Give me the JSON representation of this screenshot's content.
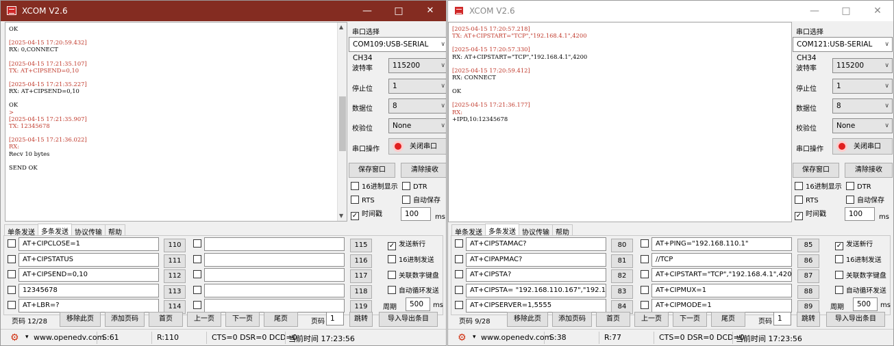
{
  "windows": [
    {
      "title": "XCOM V2.6",
      "log": [
        {
          "type": "text",
          "text": "OK"
        },
        {
          "type": "gap"
        },
        {
          "type": "ts",
          "text": "[2025-04-15 17:20:59.432]"
        },
        {
          "type": "text",
          "text": "RX: 0,CONNECT"
        },
        {
          "type": "gap"
        },
        {
          "type": "ts",
          "text": "[2025-04-15 17:21:35.107]"
        },
        {
          "type": "tx",
          "text": "TX: AT+CIPSEND=0,10"
        },
        {
          "type": "gap"
        },
        {
          "type": "ts",
          "text": "[2025-04-15 17:21:35.227]"
        },
        {
          "type": "text",
          "text": "RX: AT+CIPSEND=0,10"
        },
        {
          "type": "gap"
        },
        {
          "type": "text",
          "text": "OK"
        },
        {
          "type": "ts",
          "text": ">"
        },
        {
          "type": "ts",
          "text": "[2025-04-15 17:21:35.907]"
        },
        {
          "type": "tx",
          "text": "TX: 12345678"
        },
        {
          "type": "gap"
        },
        {
          "type": "ts",
          "text": "[2025-04-15 17:21:36.022]"
        },
        {
          "type": "ts",
          "text": "RX:"
        },
        {
          "type": "text",
          "text": "Recv 10 bytes"
        },
        {
          "type": "gap"
        },
        {
          "type": "text",
          "text": "SEND OK"
        }
      ],
      "side": {
        "port_label": "串口选择",
        "port_value": "COM109:USB-SERIAL CH34",
        "baud_label": "波特率",
        "baud_value": "115200",
        "stop_label": "停止位",
        "stop_value": "1",
        "data_label": "数据位",
        "data_value": "8",
        "parity_label": "校验位",
        "parity_value": "None",
        "op_label": "串口操作",
        "close_port": "关闭串口",
        "save_window": "保存窗口",
        "clear_recv": "清除接收",
        "hex_display": "16进制显示",
        "dtr": "DTR",
        "rts": "RTS",
        "auto_save": "自动保存",
        "timestamp": "时间戳",
        "timestamp_value": "100",
        "ms": "ms"
      },
      "tabs": [
        "单条发送",
        "多条发送",
        "协议传输",
        "帮助"
      ],
      "rows": [
        {
          "cmd": "AT+CIPCLOSE=1",
          "num": "110",
          "cmd2": "",
          "num2": "115"
        },
        {
          "cmd": "AT+CIPSTATUS",
          "num": "111",
          "cmd2": "",
          "num2": "116"
        },
        {
          "cmd": "AT+CIPSEND=0,10",
          "num": "112",
          "cmd2": "",
          "num2": "117"
        },
        {
          "cmd": "12345678",
          "num": "113",
          "cmd2": "",
          "num2": "118"
        },
        {
          "cmd": "AT+LBR=?",
          "num": "114",
          "cmd2": "",
          "num2": "119"
        }
      ],
      "opts": {
        "send_newline": "发送新行",
        "hex_send": "16进制发送",
        "link_keypad": "关联数字键盘",
        "auto_loop": "自动循环发送",
        "period_label": "周期",
        "period_value": "500",
        "ms": "ms"
      },
      "pager": {
        "page": "页码 12/28",
        "remove": "移除此页",
        "add": "添加页码",
        "first": "首页",
        "prev": "上一页",
        "next": "下一页",
        "last": "尾页",
        "page_label": "页码",
        "page_value": "1",
        "jump": "跳转",
        "import": "导入导出条目"
      },
      "status": {
        "url": "www.openedv.com",
        "s": "S:61",
        "r": "R:110",
        "lines": "CTS=0 DSR=0 DCD=0",
        "time": "当前时间 17:23:56"
      }
    },
    {
      "title": "XCOM V2.6",
      "log": [
        {
          "type": "ts",
          "text": "[2025-04-15 17:20:57.218]"
        },
        {
          "type": "tx",
          "text": "TX: AT+CIPSTART=\"TCP\",\"192.168.4.1\",4200"
        },
        {
          "type": "gap"
        },
        {
          "type": "ts",
          "text": "[2025-04-15 17:20:57.330]"
        },
        {
          "type": "text",
          "text": "RX: AT+CIPSTART=\"TCP\",\"192.168.4.1\",4200"
        },
        {
          "type": "gap"
        },
        {
          "type": "ts",
          "text": "[2025-04-15 17:20:59.412]"
        },
        {
          "type": "text",
          "text": "RX: CONNECT"
        },
        {
          "type": "gap"
        },
        {
          "type": "text",
          "text": "OK"
        },
        {
          "type": "gap"
        },
        {
          "type": "ts",
          "text": "[2025-04-15 17:21:36.177]"
        },
        {
          "type": "ts",
          "text": "RX:"
        },
        {
          "type": "text",
          "text": "+IPD,10:12345678"
        }
      ],
      "side": {
        "port_label": "串口选择",
        "port_value": "COM121:USB-SERIAL CH34",
        "baud_label": "波特率",
        "baud_value": "115200",
        "stop_label": "停止位",
        "stop_value": "1",
        "data_label": "数据位",
        "data_value": "8",
        "parity_label": "校验位",
        "parity_value": "None",
        "op_label": "串口操作",
        "close_port": "关闭串口",
        "save_window": "保存窗口",
        "clear_recv": "清除接收",
        "hex_display": "16进制显示",
        "dtr": "DTR",
        "rts": "RTS",
        "auto_save": "自动保存",
        "timestamp": "时间戳",
        "timestamp_value": "100",
        "ms": "ms"
      },
      "tabs": [
        "单条发送",
        "多条发送",
        "协议传输",
        "帮助"
      ],
      "rows": [
        {
          "cmd": "AT+CIPSTAMAC?",
          "num": "80",
          "cmd2": "AT+PING=\"192.168.110.1\"",
          "num2": "85"
        },
        {
          "cmd": "AT+CIPAPMAC?",
          "num": "81",
          "cmd2": "//TCP",
          "num2": "86"
        },
        {
          "cmd": "AT+CIPSTA?",
          "num": "82",
          "cmd2": "AT+CIPSTART=\"TCP\",\"192.168.4.1\",4200",
          "num2": "87"
        },
        {
          "cmd": "AT+CIPSTA= \"192.168.110.167\",\"192.168.1",
          "num": "83",
          "cmd2": "AT+CIPMUX=1",
          "num2": "88"
        },
        {
          "cmd": "AT+CIPSERVER=1,5555",
          "num": "84",
          "cmd2": "AT+CIPMODE=1",
          "num2": "89"
        }
      ],
      "opts": {
        "send_newline": "发送新行",
        "hex_send": "16进制发送",
        "link_keypad": "关联数字键盘",
        "auto_loop": "自动循环发送",
        "period_label": "周期",
        "period_value": "500",
        "ms": "ms"
      },
      "pager": {
        "page": "页码 9/28",
        "remove": "移除此页",
        "add": "添加页码",
        "first": "首页",
        "prev": "上一页",
        "next": "下一页",
        "last": "尾页",
        "page_label": "页码",
        "page_value": "1",
        "jump": "跳转",
        "import": "导入导出条目"
      },
      "status": {
        "url": "www.openedv.com",
        "s": "S:38",
        "r": "R:77",
        "lines": "CTS=0 DSR=0 DCD=0",
        "time": "当前时间 17:23:56"
      }
    }
  ]
}
